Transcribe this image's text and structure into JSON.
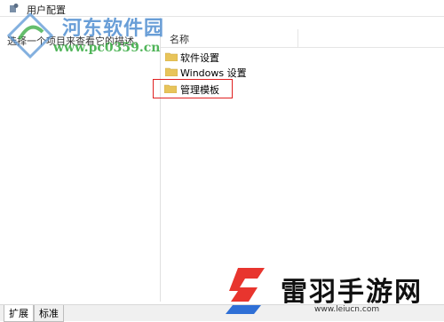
{
  "window": {
    "title": "用户配置"
  },
  "left_pane": {
    "description": "选择一个项目来查看它的描述。"
  },
  "list": {
    "column_name": "名称",
    "items": [
      {
        "label": "软件设置",
        "icon": "folder-icon"
      },
      {
        "label": "Windows 设置",
        "icon": "folder-icon"
      },
      {
        "label": "管理模板",
        "icon": "folder-icon",
        "highlighted": true
      }
    ]
  },
  "tabs": [
    {
      "label": "扩展",
      "active": true
    },
    {
      "label": "标准",
      "active": false
    }
  ],
  "watermarks": {
    "left": {
      "title": "河东软件园",
      "url": "www.pc0359.cn"
    },
    "right": {
      "title": "雷羽手游网",
      "url": "www.leiucn.com"
    }
  },
  "colors": {
    "highlight_border": "#e02020",
    "folder": "#e8c45a",
    "watermark_blue": "#4f8ed1",
    "watermark_green": "#3fae49",
    "brand_red": "#e8352e"
  }
}
